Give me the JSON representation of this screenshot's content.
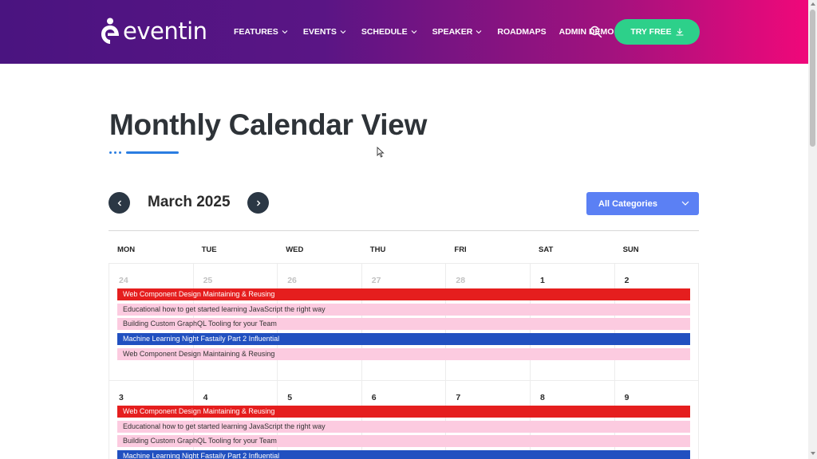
{
  "header": {
    "logo_text": "eventin",
    "nav": [
      {
        "label": "FEATURES",
        "has_dropdown": true
      },
      {
        "label": "EVENTS",
        "has_dropdown": true
      },
      {
        "label": "SCHEDULE",
        "has_dropdown": true
      },
      {
        "label": "SPEAKER",
        "has_dropdown": true
      },
      {
        "label": "ROADMAPS",
        "has_dropdown": false
      },
      {
        "label": "ADMIN DEMO",
        "has_dropdown": false
      }
    ],
    "try_button_label": "TRY FREE",
    "icons": {
      "search": "search-icon",
      "download": "download-icon"
    }
  },
  "page": {
    "title": "Monthly Calendar View"
  },
  "calendar": {
    "month_label": "March 2025",
    "category_select": "All Categories",
    "days": [
      "MON",
      "TUE",
      "WED",
      "THU",
      "FRI",
      "SAT",
      "SUN"
    ],
    "weeks": [
      {
        "dates": [
          {
            "n": "24",
            "muted": true
          },
          {
            "n": "25",
            "muted": true
          },
          {
            "n": "26",
            "muted": true
          },
          {
            "n": "27",
            "muted": true
          },
          {
            "n": "28",
            "muted": true
          },
          {
            "n": "1",
            "muted": false
          },
          {
            "n": "2",
            "muted": false
          }
        ],
        "events": [
          {
            "title": "Web Component Design Maintaining & Reusing",
            "color": "red"
          },
          {
            "title": "Educational how to get started learning JavaScript the right way",
            "color": "pink"
          },
          {
            "title": "Building Custom GraphQL Tooling for your Team",
            "color": "pink"
          },
          {
            "title": "Machine Learning Night Fastaily Part 2 Influential",
            "color": "blue"
          },
          {
            "title": "Web Component Design Maintaining & Reusing",
            "color": "pink"
          }
        ]
      },
      {
        "dates": [
          {
            "n": "3",
            "muted": false
          },
          {
            "n": "4",
            "muted": false
          },
          {
            "n": "5",
            "muted": false
          },
          {
            "n": "6",
            "muted": false
          },
          {
            "n": "7",
            "muted": false
          },
          {
            "n": "8",
            "muted": false
          },
          {
            "n": "9",
            "muted": false
          }
        ],
        "events": [
          {
            "title": "Web Component Design Maintaining & Reusing",
            "color": "red"
          },
          {
            "title": "Educational how to get started learning JavaScript the right way",
            "color": "pink"
          },
          {
            "title": "Building Custom GraphQL Tooling for your Team",
            "color": "pink"
          },
          {
            "title": "Machine Learning Night Fastaily Part 2 Influential",
            "color": "blue"
          }
        ]
      }
    ]
  },
  "colors": {
    "header_gradient_start": "#4a1480",
    "header_gradient_end": "#f0087a",
    "accent_green": "#2dd08a",
    "select_blue": "#5b80f4",
    "event_red": "#e51e1e",
    "event_pink": "#fccbe0",
    "event_blue": "#2150c0"
  }
}
